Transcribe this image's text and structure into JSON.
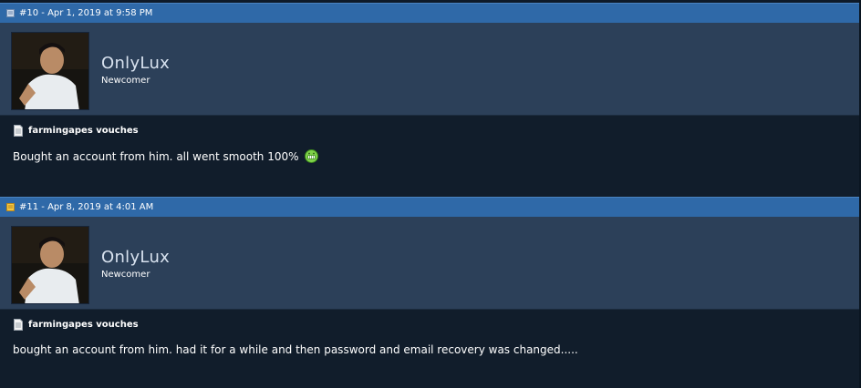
{
  "posts": [
    {
      "header": "#10 - Apr 1, 2019 at 9:58 PM",
      "username": "OnlyLux",
      "user_title": "Newcomer",
      "post_title": "farmingapes vouches",
      "content": "Bought an account from him. all went smooth 100%",
      "smiley": "grin-smiley-icon"
    },
    {
      "header": "#11 - Apr 8, 2019 at 4:01 AM",
      "username": "OnlyLux",
      "user_title": "Newcomer",
      "post_title": "farmingapes vouches",
      "content": "bought an account from him. had it for a while and then password and email recovery was changed....."
    }
  ],
  "colors": {
    "header_bar": "#2f69a8",
    "profile_bar": "#2c4059",
    "body_bg": "#111d2b"
  }
}
